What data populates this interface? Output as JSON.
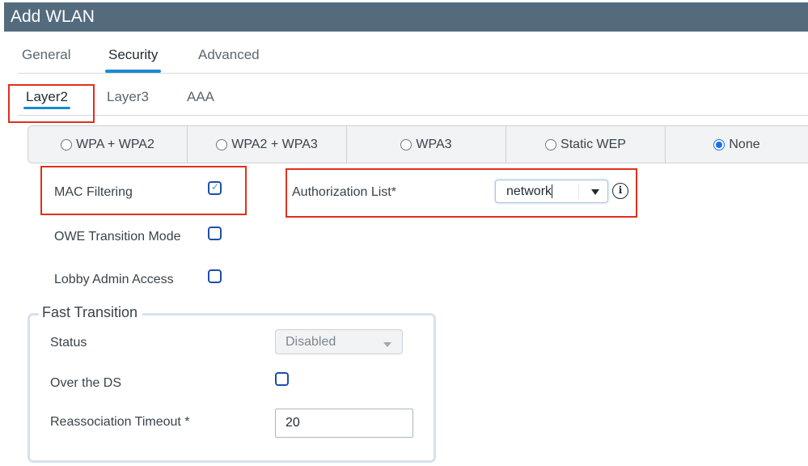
{
  "window": {
    "title": "Add WLAN"
  },
  "tabs": [
    {
      "label": "General",
      "active": false
    },
    {
      "label": "Security",
      "active": true
    },
    {
      "label": "Advanced",
      "active": false
    }
  ],
  "subtabs": [
    {
      "label": "Layer2",
      "active": true
    },
    {
      "label": "Layer3",
      "active": false
    },
    {
      "label": "AAA",
      "active": false
    }
  ],
  "security_modes": [
    {
      "label": "WPA + WPA2",
      "selected": false
    },
    {
      "label": "WPA2 + WPA3",
      "selected": false
    },
    {
      "label": "WPA3",
      "selected": false
    },
    {
      "label": "Static WEP",
      "selected": false
    },
    {
      "label": "None",
      "selected": true
    }
  ],
  "options": {
    "mac_filtering": {
      "label": "MAC Filtering",
      "checked": true
    },
    "owe_transition": {
      "label": "OWE Transition Mode",
      "checked": false
    },
    "lobby_admin": {
      "label": "Lobby Admin Access",
      "checked": false
    }
  },
  "authorization_list": {
    "label": "Authorization List*",
    "value": "network",
    "info_icon": "info-icon"
  },
  "fast_transition": {
    "legend": "Fast Transition",
    "status": {
      "label": "Status",
      "value": "Disabled"
    },
    "over_the_ds": {
      "label": "Over the DS",
      "checked": false
    },
    "reassociation_timeout": {
      "label": "Reassociation Timeout *",
      "value": "20"
    }
  },
  "colors": {
    "header": "#546b7e",
    "accent": "#1b8ad1",
    "highlight": "#e0301e",
    "checkbox": "#1d4fa8"
  }
}
